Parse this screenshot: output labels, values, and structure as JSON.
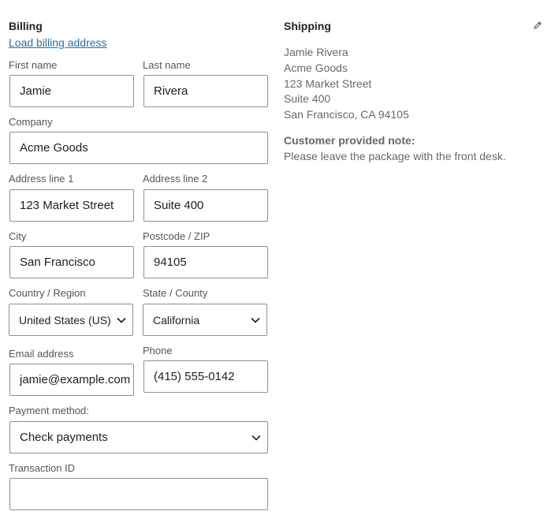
{
  "billing": {
    "title": "Billing",
    "load_link": "Load billing address",
    "first_name": {
      "label": "First name",
      "value": "Jamie"
    },
    "last_name": {
      "label": "Last name",
      "value": "Rivera"
    },
    "company": {
      "label": "Company",
      "value": "Acme Goods"
    },
    "address_1": {
      "label": "Address line 1",
      "value": "123 Market Street"
    },
    "address_2": {
      "label": "Address line 2",
      "value": "Suite 400"
    },
    "city": {
      "label": "City",
      "value": "San Francisco"
    },
    "postcode": {
      "label": "Postcode / ZIP",
      "value": "94105"
    },
    "country": {
      "label": "Country / Region",
      "value": "United States (US)"
    },
    "state": {
      "label": "State / County",
      "value": "California"
    },
    "email": {
      "label": "Email address",
      "value": "jamie@example.com"
    },
    "phone": {
      "label": "Phone",
      "value": "(415) 555-0142"
    },
    "payment_method": {
      "label": "Payment method:",
      "value": "Check payments"
    },
    "transaction_id": {
      "label": "Transaction ID",
      "value": ""
    }
  },
  "shipping": {
    "title": "Shipping",
    "edit_icon": "pencil-icon",
    "address_lines": [
      "Jamie Rivera",
      "Acme Goods",
      "123 Market Street",
      "Suite 400",
      "San Francisco, CA 94105"
    ],
    "note_label": "Customer provided note:",
    "note_text": "Please leave the package with the front desk."
  },
  "colors": {
    "link": "#2271b1",
    "border": "#8c8f94",
    "label": "#50575e",
    "muted_text": "#646970"
  }
}
